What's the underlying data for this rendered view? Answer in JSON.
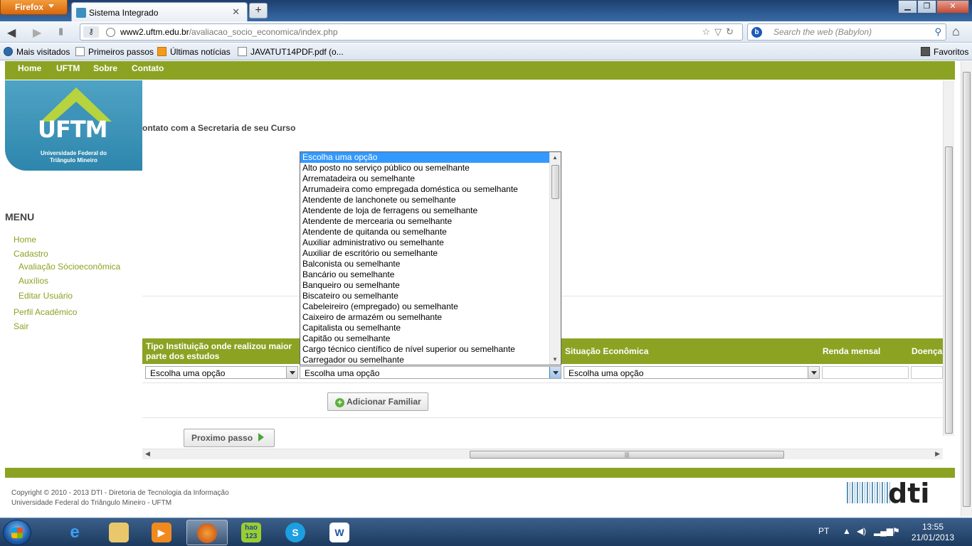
{
  "browser": {
    "app_button": "Firefox",
    "tab_title": "Sistema Integrado",
    "url_host": "www2.uftm.edu.br",
    "url_path": "/avaliacao_socio_economica/index.php",
    "search_placeholder": "Search the web (Babylon)",
    "bookmarks": [
      "Mais visitados",
      "Primeiros passos",
      "Últimas notícias",
      "JAVATUT14PDF.pdf (o..."
    ],
    "favorites_label": "Favoritos"
  },
  "site": {
    "nav": [
      "Home",
      "UFTM",
      "Sobre",
      "Contato"
    ],
    "logo_text": "UFTM",
    "logo_sub1": "Universidade Federal do",
    "logo_sub2": "Triângulo Mineiro",
    "contact_text": "ontato com a Secretaria de seu Curso",
    "menu_title": "MENU",
    "menu": {
      "home": "Home",
      "cadastro": "Cadastro",
      "avaliacao": "Avaliação Sócioeconômica",
      "auxilios": "Auxílios",
      "editar": "Editar Usuário",
      "perfil": "Perfil Acadêmico",
      "sair": "Sair"
    }
  },
  "table": {
    "headers": {
      "instituicao_line1": "Tipo Instituição onde realizou maior",
      "instituicao_line2": "parte dos estudos",
      "situacao": "Situação Econômica",
      "renda": "Renda mensal",
      "doenca": "Doença"
    },
    "select_instituicao": "Escolha uma opção",
    "select_profissao": "Escolha uma opção",
    "select_situacao": "Escolha uma opção"
  },
  "dropdown_options": [
    "Escolha uma opção",
    "Alto posto no serviço público ou semelhante",
    "Arrematadeira ou semelhante",
    "Arrumadeira como empregada doméstica ou semelhante",
    "Atendente de lanchonete ou semelhante",
    "Atendente de loja de ferragens ou semelhante",
    "Atendente de mercearia ou semelhante",
    "Atendente de quitanda ou semelhante",
    "Auxiliar administrativo ou semelhante",
    "Auxiliar de escritório ou semelhante",
    "Balconista ou semelhante",
    "Bancário ou semelhante",
    "Banqueiro ou semelhante",
    "Biscateiro ou semelhante",
    "Cabeleireiro (empregado) ou semelhante",
    "Caixeiro de armazém ou semelhante",
    "Capitalista ou semelhante",
    "Capitão ou semelhante",
    "Cargo técnico científico de nível superior ou semelhante",
    "Carregador ou semelhante"
  ],
  "buttons": {
    "add_familiar": "Adicionar Familiar",
    "next_step": "Proximo passo"
  },
  "footer": {
    "line1": "Copyright © 2010 - 2013 DTI - Diretoria de Tecnologia da Informação",
    "line2": "Universidade Federal do Triângulo Mineiro - UFTM",
    "dti": "dti"
  },
  "taskbar": {
    "apps": [
      "Internet Explorer",
      "Windows Explorer",
      "Media Player",
      "Firefox",
      "hao123",
      "Skype",
      "Word"
    ],
    "hao_label": "hao",
    "hao_sub": "123",
    "lang": "PT",
    "time": "13:55",
    "date": "21/01/2013"
  },
  "colors": {
    "accent_green": "#8ca223",
    "selection_blue": "#3399ff"
  }
}
